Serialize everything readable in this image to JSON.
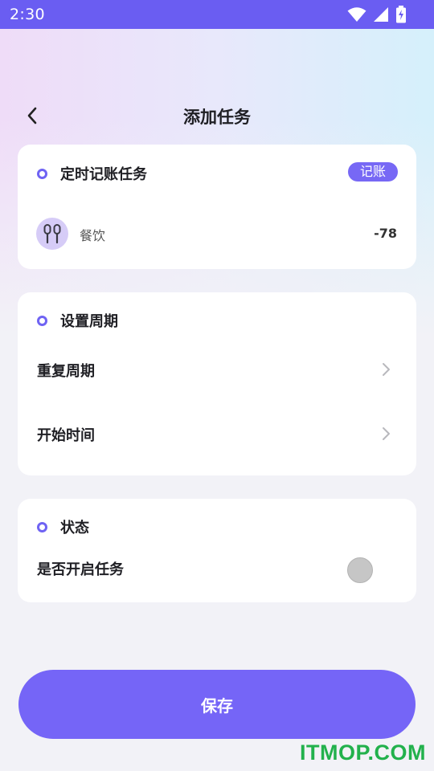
{
  "status_bar": {
    "time": "2:30"
  },
  "header": {
    "title": "添加任务"
  },
  "card_task": {
    "title": "定时记账任务",
    "tag": "记账",
    "category": {
      "label": "餐饮",
      "icon": "fork-knife-icon",
      "amount": "-78"
    }
  },
  "card_period": {
    "title": "设置周期",
    "rows": [
      {
        "label": "重复周期"
      },
      {
        "label": "开始时间"
      }
    ]
  },
  "card_status": {
    "title": "状态",
    "toggle_label": "是否开启任务",
    "enabled": false
  },
  "save_button": {
    "label": "保存"
  },
  "watermark": "ITMOP.COM",
  "colors": {
    "accent": "#7565f7",
    "status_bar": "#6a5df2",
    "watermark": "#22b14c"
  }
}
